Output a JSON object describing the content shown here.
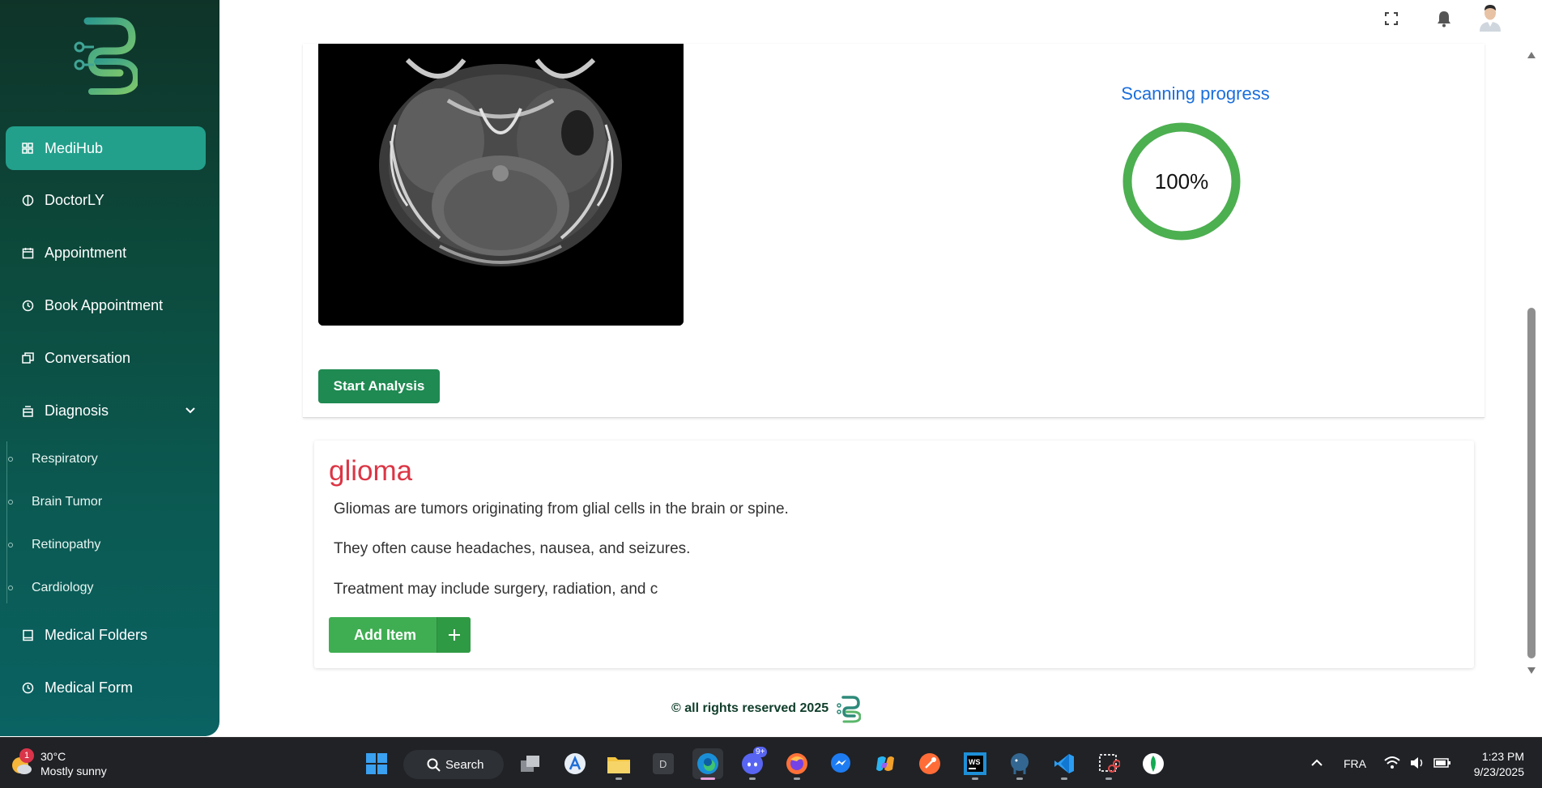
{
  "sidebar": {
    "items": [
      {
        "label": "MediHub",
        "icon": "grid-icon",
        "active": true
      },
      {
        "label": "DoctorLY",
        "icon": "brain-icon"
      },
      {
        "label": "Appointment",
        "icon": "calendar-icon"
      },
      {
        "label": "Book Appointment",
        "icon": "clock-icon"
      },
      {
        "label": "Conversation",
        "icon": "chat-icon"
      },
      {
        "label": "Diagnosis",
        "icon": "lab-icon"
      }
    ],
    "diagnosis_sub": [
      "Respiratory",
      "Brain Tumor",
      "Retinopathy",
      "Cardiology"
    ],
    "bottom_items": [
      {
        "label": "Medical Folders",
        "icon": "book-icon"
      },
      {
        "label": "Medical Form",
        "icon": "history-icon"
      }
    ]
  },
  "analysis": {
    "progress_title": "Scanning progress",
    "progress_value": "100%",
    "progress_fraction": 1.0,
    "start_button": "Start Analysis"
  },
  "result": {
    "title": "glioma",
    "lines": [
      "Gliomas are tumors originating from glial cells in the brain or spine.",
      "They often cause headaches, nausea, and seizures.",
      "Treatment may include surgery, radiation, and c"
    ],
    "add_button": "Add Item"
  },
  "footer": {
    "text": "© all rights reserved 2025"
  },
  "taskbar": {
    "weather_temp": "30°C",
    "weather_desc": "Mostly sunny",
    "weather_badge": "1",
    "search_label": "Search",
    "lang": "FRA",
    "time": "1:23 PM",
    "date": "9/23/2025",
    "discord_badge": "9+"
  },
  "colors": {
    "accent_green": "#1f8a52",
    "active_nav": "#22a08c",
    "progress_ring": "#4caf50",
    "diagnosis_title": "#dc3545",
    "progress_title": "#1a6fdc"
  }
}
